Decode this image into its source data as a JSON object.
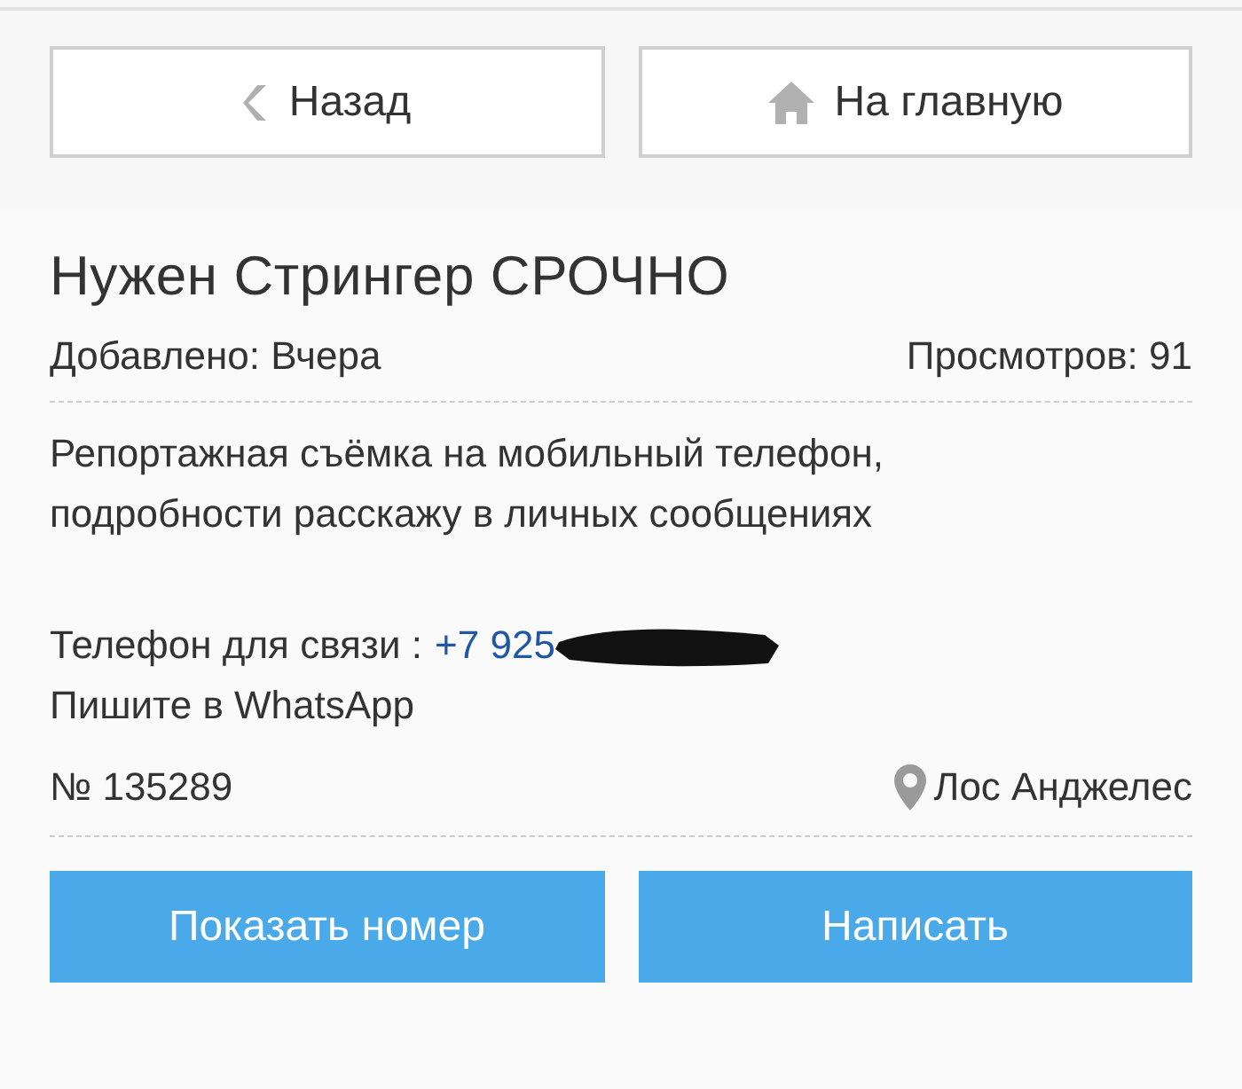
{
  "nav_buttons": [
    {
      "kind": "back",
      "label": "Назад"
    },
    {
      "kind": "home",
      "label": "На главную"
    }
  ],
  "listing": {
    "title": "Нужен Стрингер СРОЧНО",
    "added": "Добавлено: Вчера",
    "views": "Просмотров: 91",
    "description": "Репортажная съёмка на мобильный телефон, подробности расскажу в личных сообщениях",
    "phone_label": "Телефон для связи :",
    "phone": "+7 925",
    "note": "Пишите в WhatsApp",
    "number": "№ 135289",
    "location": "Лос Анджелес"
  },
  "action_buttons": [
    "Показать номер",
    "Написать"
  ]
}
